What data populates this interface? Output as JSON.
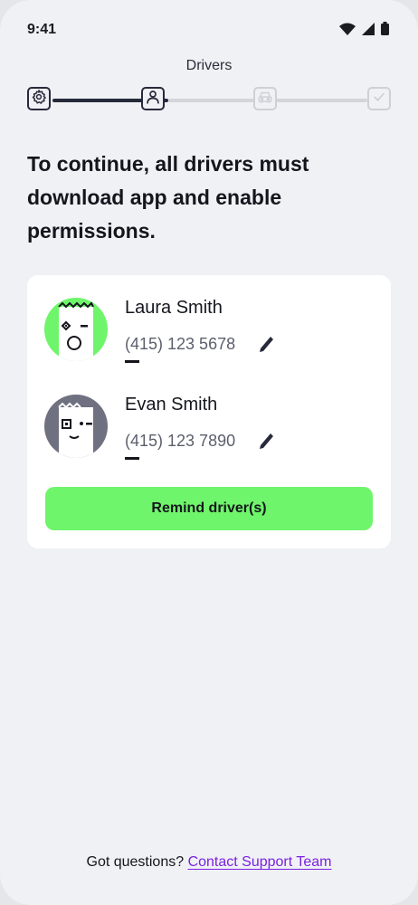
{
  "status_bar": {
    "time": "9:41"
  },
  "header": {
    "title": "Drivers"
  },
  "stepper": {
    "steps": [
      {
        "icon": "gear-icon",
        "state": "done"
      },
      {
        "icon": "person-icon",
        "state": "current"
      },
      {
        "icon": "car-icon",
        "state": "upcoming"
      },
      {
        "icon": "checkmark-icon",
        "state": "upcoming"
      }
    ]
  },
  "main": {
    "heading": "To continue, all drivers must download app and enable permissions.",
    "drivers": [
      {
        "name": "Laura Smith",
        "phone": "(415) 123 5678",
        "avatar_color": "#6ff56b"
      },
      {
        "name": "Evan Smith",
        "phone": "(415) 123 7890",
        "avatar_color": "#6f7080"
      }
    ],
    "remind_button": "Remind driver(s)"
  },
  "footer": {
    "question": "Got questions?",
    "link": "Contact Support Team"
  },
  "colors": {
    "accent_green": "#6ff56b",
    "link_purple": "#7a21e0",
    "dark": "#262a3a",
    "background": "#f0f1f5"
  }
}
